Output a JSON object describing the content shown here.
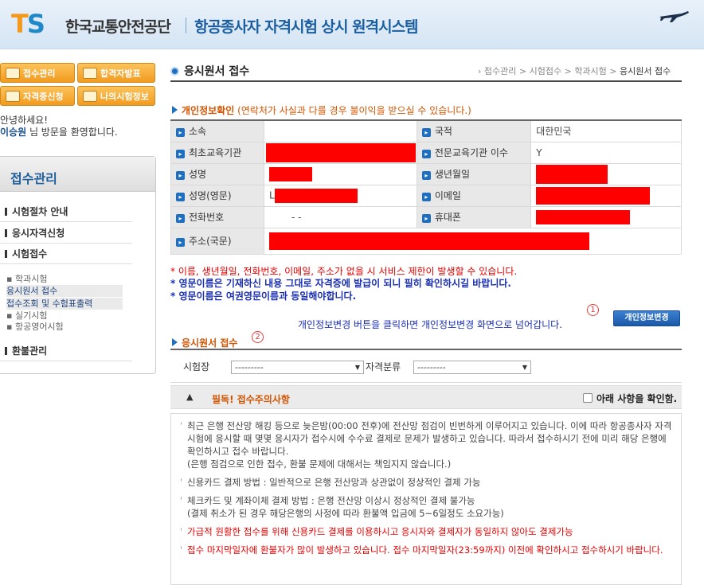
{
  "header": {
    "logo_t": "T",
    "logo_s": "S",
    "org_name": "한국교통안전공단",
    "system_name": "항공종사자 자격시험 상시 원격시스템"
  },
  "quick_buttons": [
    {
      "label": "접수관리"
    },
    {
      "label": "합격자발표"
    },
    {
      "label": "자격증신청"
    },
    {
      "label": "나의시험정보"
    }
  ],
  "welcome": {
    "line1": "안녕하세요!",
    "user": "이승원",
    "line2": " 님 방문을 환영합니다."
  },
  "sidebar": {
    "title": "접수관리",
    "menus": [
      "시험절차 안내",
      "응시자격신청",
      "시험접수",
      "환불관리"
    ],
    "subs": [
      "학과시험",
      "응시원서 접수",
      "접수조회 및 수험표출력",
      "실기시험",
      "항공영어시험"
    ]
  },
  "page": {
    "title": "응시원서 접수",
    "breadcrumb": [
      "접수관리",
      "시험접수",
      "학과시험",
      "응시원서 접수"
    ]
  },
  "personal_section": {
    "heading": "개인정보확인",
    "note": " (연락처가 사실과 다를 경우 불이익을 받으실 수 있습니다.)",
    "rows": [
      {
        "l1": "소속",
        "v1": "",
        "l2": "국적",
        "v2": "대한민국"
      },
      {
        "l1": "최초교육기관",
        "v1": "",
        "l2": "전문교육기관 이수",
        "v2": "Y"
      },
      {
        "l1": "성명",
        "v1": "",
        "l2": "생년월일",
        "v2": ""
      },
      {
        "l1": "성명(영문)",
        "v1": "L",
        "l2": "이메일",
        "v2": ""
      },
      {
        "l1": "전화번호",
        "v1": "-          -",
        "l2": "휴대폰",
        "v2": ""
      },
      {
        "l1": "주소(국문)",
        "v1": ""
      }
    ]
  },
  "warnings": {
    "w1": "* 이름, 생년월일, 전화번호, 이메일, 주소가 없을 시 서비스 제한이 발생할 수 있습니다.",
    "w2": "* 영문이름은 기재하신 내용 그대로 자격증에 발급이 되니 필히 확인하시길 바랍니다.",
    "w3": "* 영문이름은 여권영문이름과 동일해야합니다."
  },
  "change_info": {
    "text": "개인정보변경 버튼을 클릭하면 개인정보변경 화면으로 넘어갑니다.",
    "marker": "1",
    "button": "개인정보변경"
  },
  "application_section": {
    "heading": "응시원서 접수",
    "marker": "2",
    "exam_site_label": "시험장",
    "exam_site_value": "---------",
    "qualification_label": "자격분류",
    "qualification_value": "---------"
  },
  "notice": {
    "title": "필독! 접수주의사항",
    "confirm_label": "아래 사항을 확인함.",
    "paragraphs": [
      {
        "text": "최근 은행 전산망 해킹 등으로 늦은밤(00:00 전후)에 전산망 점검이 빈번하게 이루어지고 있습니다. 이에 따라 항공종사자 자격시험에 응시할 때 몇몇 응시자가 접수시에 수수료 결제로 문제가 발생하고 있습니다. 따라서 접수하시기 전에 미리 해당 은행에 확인하시고 접수 바랍니다.",
        "extra": "(은행 점검으로 인한 접수, 환불 문제에 대해서는 책임지지 않습니다.)",
        "red": false
      },
      {
        "text": "신용카드 결제 방법 : 일반적으로 은행 전산망과 상관없이 정상적인 결제 가능",
        "extra": "",
        "red": false
      },
      {
        "text": "체크카드 및 계좌이체 결제 방법 : 은행 전산망 이상시 정상적인 결제 불가능",
        "extra": "(결제 취소가 된 경우 해당은행의 사정에 따라 환불액 입금에 5~6일정도 소요가능)",
        "red": false
      },
      {
        "text": "가급적 원활한 접수를 위해 신용카드 결제를 이용하시고 응시자와 결제자가 동일하지 않아도 결제가능",
        "extra": "",
        "red": true
      },
      {
        "text": "접수 마지막일자에 환불자가 많이 발생하고 있습니다. 접수 마지막일자(23:59까지) 이전에 확인하시고 접수하시기 바랍니다.",
        "extra": "",
        "red": true
      }
    ]
  },
  "colors": {
    "accent": "#1f6fc0",
    "orange": "#f39a1e",
    "redact": "#ff0000"
  }
}
